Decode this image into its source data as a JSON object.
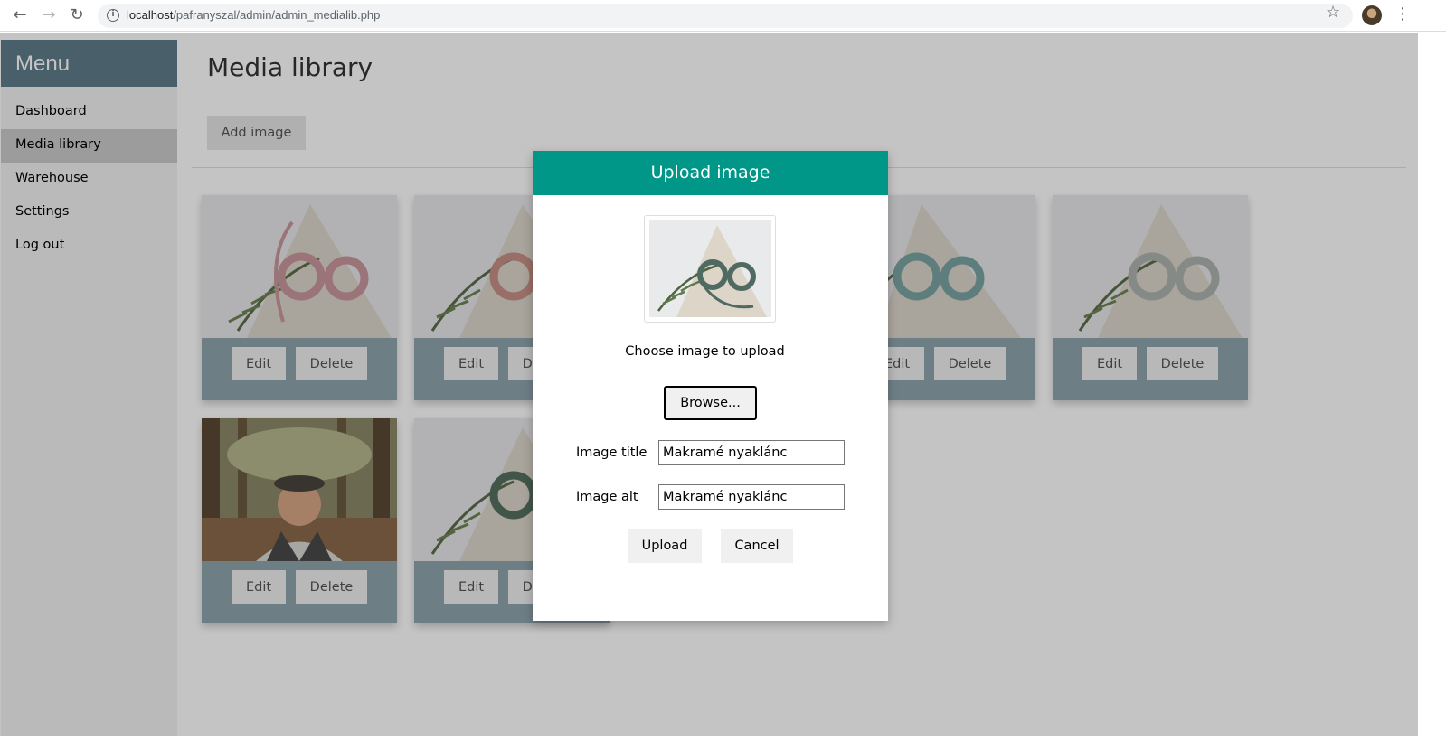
{
  "browser": {
    "url_host": "localhost",
    "url_path": "/pafranyszal/admin/admin_medialib.php"
  },
  "sidebar": {
    "title": "Menu",
    "items": [
      {
        "label": "Dashboard"
      },
      {
        "label": "Media library",
        "active": true
      },
      {
        "label": "Warehouse"
      },
      {
        "label": "Settings"
      },
      {
        "label": "Log out"
      }
    ]
  },
  "main": {
    "title": "Media library",
    "add_button": "Add image",
    "cards": [
      {
        "image": "macrame-necklace-pink",
        "edit": "Edit",
        "delete": "Delete"
      },
      {
        "image": "macrame-necklace-rose",
        "edit": "Edit",
        "delete": "Delete"
      },
      {
        "image": "macrame-necklace-teal",
        "edit": "Edit",
        "delete": "Delete"
      },
      {
        "image": "macrame-necklace-grey",
        "edit": "Edit",
        "delete": "Delete"
      },
      {
        "image": "portrait-man-forest",
        "edit": "Edit",
        "delete": "Delete"
      },
      {
        "image": "macrame-necklace-green",
        "edit": "Edit",
        "delete": "Delete"
      }
    ]
  },
  "modal": {
    "title": "Upload image",
    "choose_label": "Choose image to upload",
    "browse_button": "Browse...",
    "title_label": "Image title",
    "title_value": "Makramé nyaklánc",
    "alt_label": "Image alt",
    "alt_value": "Makramé nyaklánc",
    "upload_button": "Upload",
    "cancel_button": "Cancel"
  },
  "colors": {
    "sidebar_header": "#607d8b",
    "modal_header": "#009688",
    "card_footer": "#8fa4ae"
  }
}
